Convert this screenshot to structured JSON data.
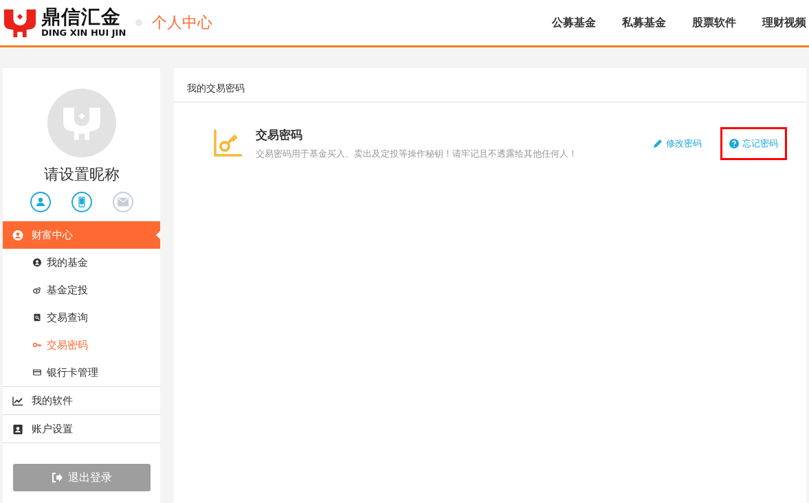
{
  "header": {
    "logo": {
      "title": "鼎信汇金",
      "subtitle": "DING XIN HUI JIN"
    },
    "section_title": "个人中心",
    "nav": [
      "公募基金",
      "私募基金",
      "股票软件",
      "理财视频"
    ]
  },
  "profile": {
    "nickname": "请设置昵称",
    "verifications": [
      {
        "kind": "user",
        "verified": true
      },
      {
        "kind": "phone",
        "verified": true
      },
      {
        "kind": "email",
        "verified": false
      }
    ]
  },
  "sidebar": {
    "items": [
      {
        "label": "财富中心",
        "kind": "user",
        "selected": true,
        "children": [
          {
            "label": "我的基金",
            "kind": "user",
            "selected": false
          },
          {
            "label": "基金定投",
            "kind": "weibo",
            "selected": false
          },
          {
            "label": "交易查询",
            "kind": "search-doc",
            "selected": false
          },
          {
            "label": "交易密码",
            "kind": "key",
            "selected": true
          },
          {
            "label": "银行卡管理",
            "kind": "card",
            "selected": false
          }
        ]
      },
      {
        "label": "我的软件",
        "kind": "chart",
        "selected": false
      },
      {
        "label": "账户设置",
        "kind": "contact",
        "selected": false
      }
    ],
    "logout": "退出登录"
  },
  "main": {
    "breadcrumb": "我的交易密码",
    "card": {
      "title": "交易密码",
      "description": "交易密码用于基金买入、卖出及定投等操作秘钥！请牢记且不透露给其他任何人！",
      "actions": [
        {
          "label": "修改密码",
          "kind": "edit",
          "highlighted": false
        },
        {
          "label": "忘记密码",
          "kind": "help",
          "highlighted": true
        }
      ]
    }
  }
}
